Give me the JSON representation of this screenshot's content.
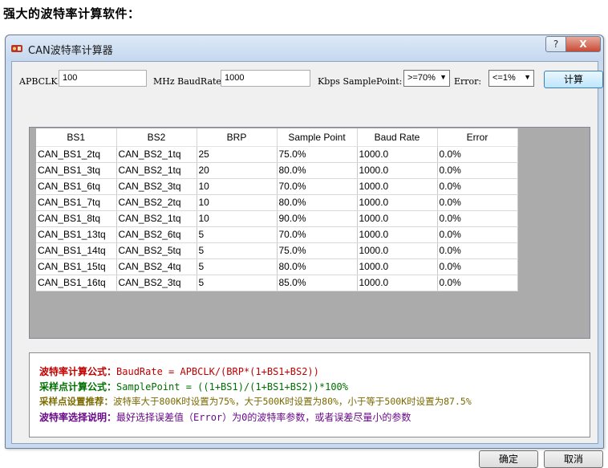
{
  "doc_heading": "强大的波特率计算软件：",
  "window": {
    "title": "CAN波特率计算器",
    "help_label": "?",
    "close_label": "X"
  },
  "inputs": {
    "apbclk_label": "APBCLK:",
    "apbclk_value": "100",
    "mhz_baudrate_label": "MHz BaudRate:",
    "baudrate_value": "1000",
    "kbps_samplepoint_label": "Kbps SamplePoint:",
    "samplepoint_selected": ">=70%",
    "error_label": "Error:",
    "error_selected": "<=1%",
    "calc_button": "计算"
  },
  "table": {
    "headers": [
      "BS1",
      "BS2",
      "BRP",
      "Sample Point",
      "Baud Rate",
      "Error"
    ],
    "rows": [
      [
        "CAN_BS1_2tq",
        "CAN_BS2_1tq",
        "25",
        "75.0%",
        "1000.0",
        "0.0%"
      ],
      [
        "CAN_BS1_3tq",
        "CAN_BS2_1tq",
        "20",
        "80.0%",
        "1000.0",
        "0.0%"
      ],
      [
        "CAN_BS1_6tq",
        "CAN_BS2_3tq",
        "10",
        "70.0%",
        "1000.0",
        "0.0%"
      ],
      [
        "CAN_BS1_7tq",
        "CAN_BS2_2tq",
        "10",
        "80.0%",
        "1000.0",
        "0.0%"
      ],
      [
        "CAN_BS1_8tq",
        "CAN_BS2_1tq",
        "10",
        "90.0%",
        "1000.0",
        "0.0%"
      ],
      [
        "CAN_BS1_13tq",
        "CAN_BS2_6tq",
        "5",
        "70.0%",
        "1000.0",
        "0.0%"
      ],
      [
        "CAN_BS1_14tq",
        "CAN_BS2_5tq",
        "5",
        "75.0%",
        "1000.0",
        "0.0%"
      ],
      [
        "CAN_BS1_15tq",
        "CAN_BS2_4tq",
        "5",
        "80.0%",
        "1000.0",
        "0.0%"
      ],
      [
        "CAN_BS1_16tq",
        "CAN_BS2_3tq",
        "5",
        "85.0%",
        "1000.0",
        "0.0%"
      ]
    ]
  },
  "info": {
    "line1_label": "波特率计算公式：",
    "line1_text": "BaudRate = APBCLK/(BRP*(1+BS1+BS2))",
    "line1_color": "#c00000",
    "line2_label": "采样点计算公式：",
    "line2_text": "SamplePoint = ((1+BS1)/(1+BS1+BS2))*100%",
    "line2_color": "#007000",
    "line3_label": "采样点设置推荐：",
    "line3_text": "波特率大于800K时设置为75%，大于500K时设置为80%，小于等于500K时设置为87.5%",
    "line3_color": "#7a6a00",
    "line4_label": "波特率选择说明：",
    "line4_text": "最好选择误差值（Error）为0的波特率参数，或者误差尽量小的参数",
    "line4_color": "#6a0a8a"
  },
  "footer": {
    "ok_button": "确定",
    "cancel_button": "取消"
  }
}
